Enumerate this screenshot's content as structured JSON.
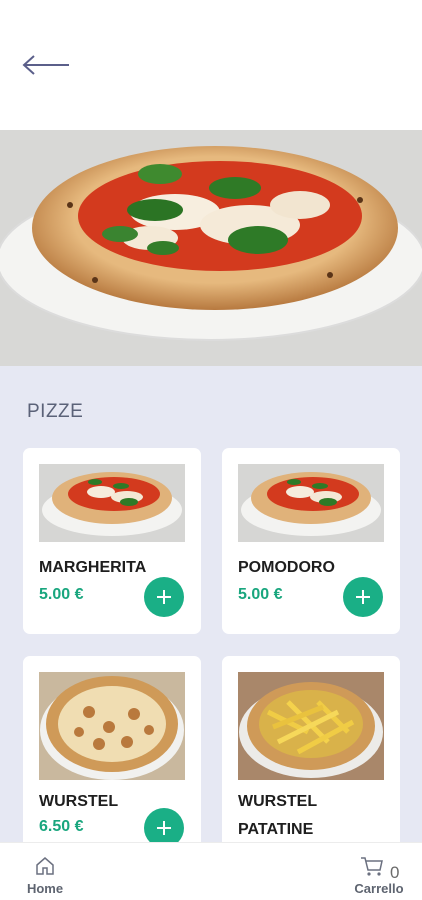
{
  "header": {
    "back_icon": "arrow-left-icon"
  },
  "hero": {
    "image": "margherita-pizza-photo"
  },
  "section": {
    "title": "PIZZE"
  },
  "products": [
    {
      "name": "MARGHERITA",
      "price": "5.00 €",
      "image": "margherita-pizza-photo"
    },
    {
      "name": "POMODORO",
      "price": "5.00 €",
      "image": "margherita-pizza-photo"
    },
    {
      "name": "WURSTEL",
      "price": "6.50 €",
      "image": "wurstel-pizza-photo"
    },
    {
      "name": "WURSTEL PATATINE",
      "price": "",
      "image": "wurstel-fries-pizza-photo"
    }
  ],
  "bottom_nav": {
    "home_label": "Home",
    "cart_label": "Carrello",
    "cart_count": "0"
  },
  "colors": {
    "accent": "#1aaf86",
    "price": "#19a67e",
    "section_bg": "#e6e8f3",
    "section_title": "#5b6278"
  }
}
